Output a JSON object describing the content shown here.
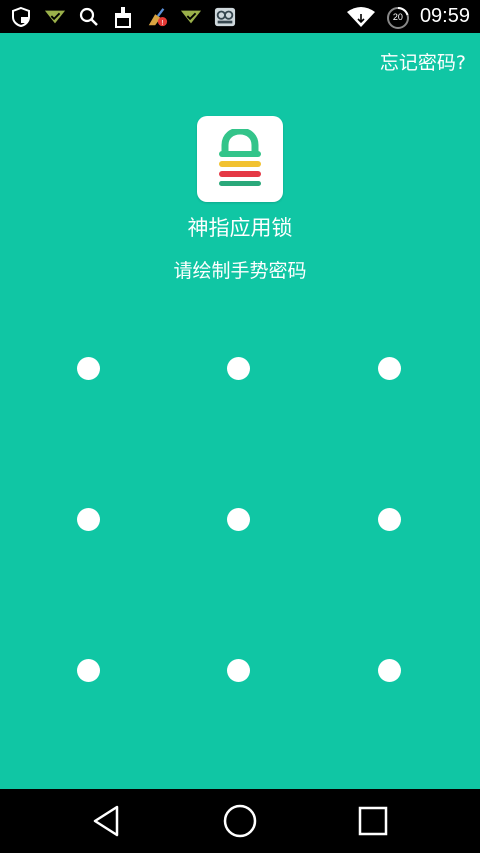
{
  "status_bar": {
    "time": "09:59",
    "battery_level": "20",
    "left_icons": [
      "shield-lock-icon",
      "signal-check-icon",
      "search-icon",
      "cleaner-icon",
      "broom-alert-icon",
      "signal-check-icon",
      "game-app-icon"
    ],
    "right_icons": [
      "wifi-icon",
      "battery-icon"
    ]
  },
  "header": {
    "forgot_password": "忘记密码?"
  },
  "app": {
    "icon": "padlock-icon",
    "name": "神指应用锁",
    "instruction": "请绘制手势密码"
  },
  "pattern": {
    "rows": 3,
    "cols": 3
  },
  "nav_bar": {
    "buttons": [
      "back-icon",
      "home-icon",
      "recents-icon"
    ]
  },
  "colors": {
    "background": "#10c6a4",
    "bars": "#000000",
    "text": "#ffffff"
  }
}
